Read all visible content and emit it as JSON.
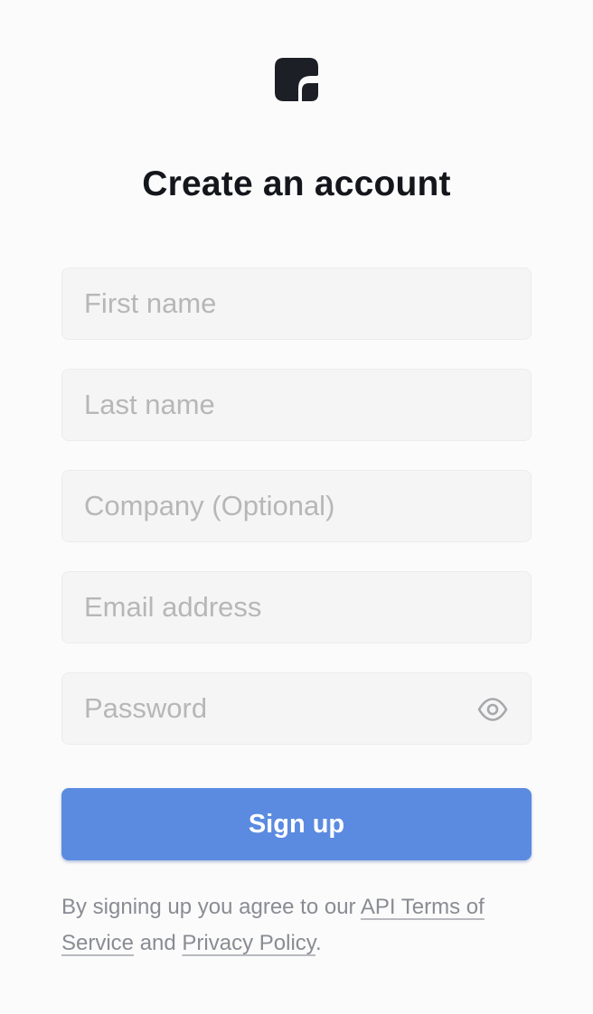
{
  "header": {
    "logo_icon": "brand-logo-icon",
    "title": "Create an account"
  },
  "form": {
    "first_name": {
      "placeholder": "First name",
      "value": ""
    },
    "last_name": {
      "placeholder": "Last name",
      "value": ""
    },
    "company": {
      "placeholder": "Company (Optional)",
      "value": ""
    },
    "email": {
      "placeholder": "Email address",
      "value": ""
    },
    "password": {
      "placeholder": "Password",
      "value": "",
      "toggle_icon": "eye-icon"
    },
    "submit_label": "Sign up"
  },
  "terms": {
    "prefix": "By signing up you agree to our ",
    "tos_link": "API Terms of Service",
    "middle": " and ",
    "privacy_link": "Privacy Policy",
    "suffix": "."
  },
  "colors": {
    "background": "#fbfbfb",
    "title": "#14161c",
    "field_bg": "#f5f5f5",
    "placeholder": "#b7b7b9",
    "primary_button": "#5b8be0",
    "muted_text": "#8a8c93"
  }
}
